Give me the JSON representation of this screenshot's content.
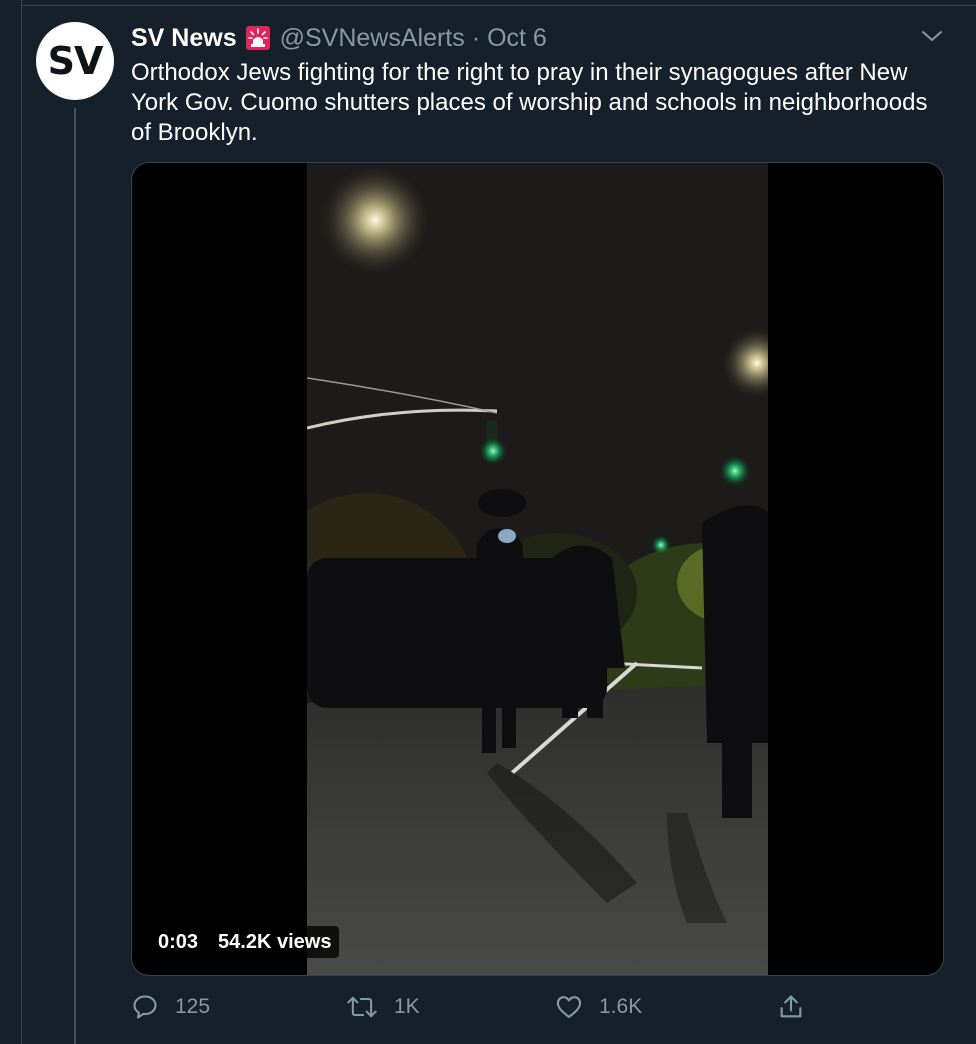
{
  "tweet": {
    "display_name": "SV News",
    "handle": "@SVNewsAlerts",
    "separator": "·",
    "date": "Oct 6",
    "avatar_text": "SV",
    "text": "Orthodox Jews fighting for the right to pray in their synagogues after New York Gov. Cuomo shutters places of worship and schools in neighborhoods of Brooklyn.",
    "badge_icon": "siren-icon",
    "menu_icon": "chevron-down-icon"
  },
  "video": {
    "time": "0:03",
    "views": "54.2K views"
  },
  "actions": {
    "reply_count": "125",
    "retweet_count": "1K",
    "like_count": "1.6K",
    "reply_icon": "reply-icon",
    "retweet_icon": "retweet-icon",
    "like_icon": "heart-icon",
    "share_icon": "share-icon"
  },
  "colors": {
    "background": "#15202b",
    "border": "#38444d",
    "secondary_text": "#8899a6",
    "primary_text": "#ffffff"
  }
}
